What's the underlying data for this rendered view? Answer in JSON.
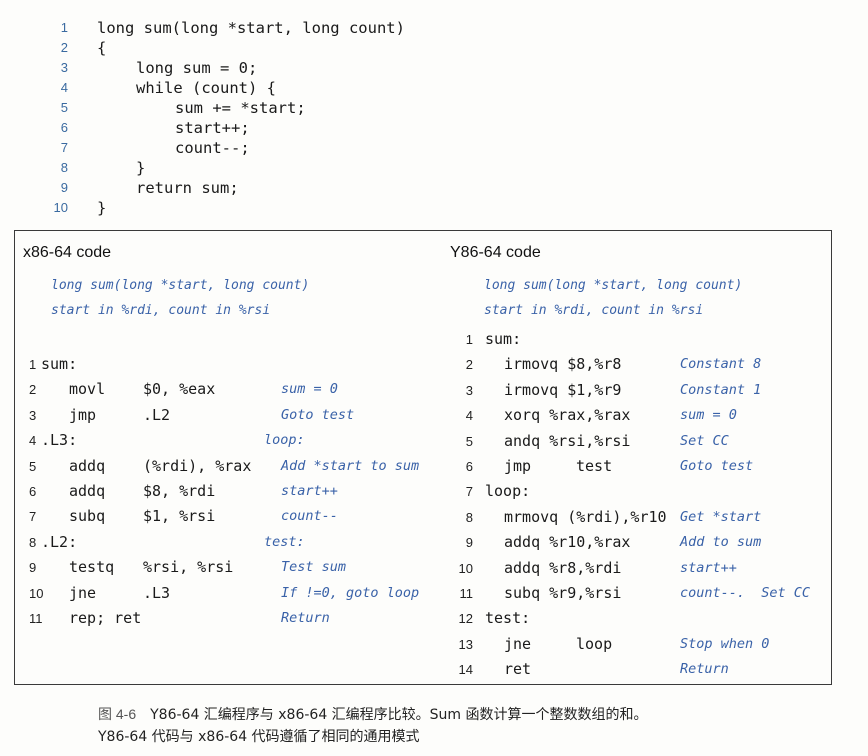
{
  "c_code": [
    {
      "n": "1",
      "indent": 0,
      "text": "long sum(long *start, long count)"
    },
    {
      "n": "2",
      "indent": 0,
      "text": "{"
    },
    {
      "n": "3",
      "indent": 1,
      "text": "long sum = 0;"
    },
    {
      "n": "4",
      "indent": 1,
      "text": "while (count) {"
    },
    {
      "n": "5",
      "indent": 2,
      "text": "sum += *start;"
    },
    {
      "n": "6",
      "indent": 2,
      "text": "start++;"
    },
    {
      "n": "7",
      "indent": 2,
      "text": "count--;"
    },
    {
      "n": "8",
      "indent": 1,
      "text": "}"
    },
    {
      "n": "9",
      "indent": 1,
      "text": "return sum;"
    },
    {
      "n": "10",
      "indent": 0,
      "text": "}"
    }
  ],
  "x86": {
    "title": "x86-64 code",
    "header_comments": [
      "long sum(long *start, long count)",
      "start in %rdi, count in %rsi"
    ],
    "lines": [
      {
        "n": "1",
        "label": "sum:",
        "instr": "",
        "ops": "",
        "comment": "",
        "label_comment": ""
      },
      {
        "n": "2",
        "label": "",
        "instr": "movl",
        "ops": "$0, %eax",
        "comment": "sum = 0",
        "label_comment": ""
      },
      {
        "n": "3",
        "label": "",
        "instr": "jmp",
        "ops": ".L2",
        "comment": "Goto test",
        "label_comment": ""
      },
      {
        "n": "4",
        "label": ".L3:",
        "instr": "",
        "ops": "",
        "comment": "",
        "label_comment": "loop:"
      },
      {
        "n": "5",
        "label": "",
        "instr": "addq",
        "ops": "(%rdi), %rax",
        "comment": "Add *start to sum",
        "label_comment": ""
      },
      {
        "n": "6",
        "label": "",
        "instr": "addq",
        "ops": "$8, %rdi",
        "comment": "start++",
        "label_comment": ""
      },
      {
        "n": "7",
        "label": "",
        "instr": "subq",
        "ops": "$1, %rsi",
        "comment": "count--",
        "label_comment": ""
      },
      {
        "n": "8",
        "label": ".L2:",
        "instr": "",
        "ops": "",
        "comment": "",
        "label_comment": "test:"
      },
      {
        "n": "9",
        "label": "",
        "instr": "testq",
        "ops": "%rsi, %rsi",
        "comment": "Test sum",
        "label_comment": ""
      },
      {
        "n": "10",
        "label": "",
        "instr": "jne",
        "ops": ".L3",
        "comment": "If !=0, goto loop",
        "label_comment": ""
      },
      {
        "n": "11",
        "label": "",
        "instr": "rep; ret",
        "ops": "",
        "comment": "Return",
        "label_comment": ""
      }
    ]
  },
  "y86": {
    "title": "Y86-64 code",
    "header_comments": [
      "long sum(long *start, long count)",
      "start in %rdi, count in %rsi"
    ],
    "lines": [
      {
        "n": "1",
        "label": "sum:",
        "instr": "",
        "ops": "",
        "comment": ""
      },
      {
        "n": "2",
        "label": "",
        "instr": "irmovq $8,%r8",
        "ops": "",
        "comment": "Constant 8"
      },
      {
        "n": "3",
        "label": "",
        "instr": "irmovq $1,%r9",
        "ops": "",
        "comment": "Constant 1"
      },
      {
        "n": "4",
        "label": "",
        "instr": "xorq %rax,%rax",
        "ops": "",
        "comment": "sum = 0"
      },
      {
        "n": "5",
        "label": "",
        "instr": "andq %rsi,%rsi",
        "ops": "",
        "comment": "Set CC"
      },
      {
        "n": "6",
        "label": "",
        "instr": "jmp",
        "ops": "test",
        "comment": "Goto test"
      },
      {
        "n": "7",
        "label": "loop:",
        "instr": "",
        "ops": "",
        "comment": ""
      },
      {
        "n": "8",
        "label": "",
        "instr": "mrmovq (%rdi),%r10",
        "ops": "",
        "comment": "Get *start"
      },
      {
        "n": "9",
        "label": "",
        "instr": "addq %r10,%rax",
        "ops": "",
        "comment": "Add to sum"
      },
      {
        "n": "10",
        "label": "",
        "instr": "addq %r8,%rdi",
        "ops": "",
        "comment": "start++"
      },
      {
        "n": "11",
        "label": "",
        "instr": "subq %r9,%rsi",
        "ops": "",
        "comment": "count--.  Set CC"
      },
      {
        "n": "12",
        "label": "test:",
        "instr": "",
        "ops": "",
        "comment": ""
      },
      {
        "n": "13",
        "label": "",
        "instr": "jne",
        "ops": "loop",
        "comment": "Stop when 0"
      },
      {
        "n": "14",
        "label": "",
        "instr": "ret",
        "ops": "",
        "comment": "Return"
      }
    ]
  },
  "caption": {
    "figure": "图 4-6",
    "line1": "Y86-64 汇编程序与 x86-64 汇编程序比较。Sum 函数计算一个整数数组的和。",
    "line2": "Y86-64 代码与 x86-64 代码遵循了相同的通用模式"
  }
}
